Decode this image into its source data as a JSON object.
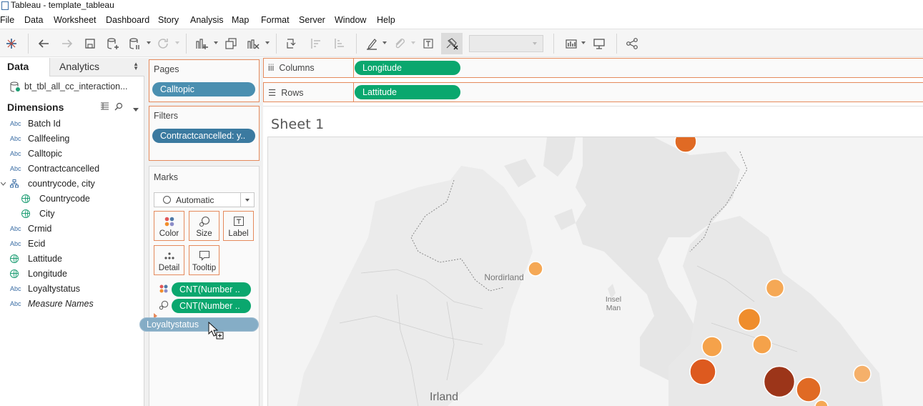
{
  "window": {
    "title": "Tableau - template_tableau"
  },
  "menu": [
    "File",
    "Data",
    "Worksheet",
    "Dashboard",
    "Story",
    "Analysis",
    "Map",
    "Format",
    "Server",
    "Window",
    "Help"
  ],
  "toolbar": {
    "icons": [
      "tableau-logo-icon",
      "undo-icon",
      "redo-icon",
      "save-icon",
      "new-data-source-icon",
      "pause-updates-icon",
      "refresh-icon",
      "new-worksheet-icon",
      "duplicate-sheet-icon",
      "clear-sheet-icon",
      "swap-icon",
      "sort-ascending-icon",
      "sort-descending-icon",
      "highlight-icon",
      "group-icon",
      "show-labels-icon",
      "fix-axes-icon",
      "fit-select",
      "show-me-icon",
      "presentation-icon",
      "share-icon"
    ],
    "fit_select_value": ""
  },
  "data_pane": {
    "tabs": {
      "data": "Data",
      "analytics": "Analytics"
    },
    "datasource": "bt_tbl_all_cc_interaction...",
    "dimensions_heading": "Dimensions",
    "fields": [
      {
        "type": "Abc",
        "name": "Batch Id"
      },
      {
        "type": "Abc",
        "name": "Callfeeling"
      },
      {
        "type": "Abc",
        "name": "Calltopic"
      },
      {
        "type": "Abc",
        "name": "Contractcancelled"
      },
      {
        "type": "hierarchy",
        "name": "countrycode, city"
      },
      {
        "type": "geo",
        "name": "Countrycode",
        "child": true
      },
      {
        "type": "geo",
        "name": "City",
        "child": true
      },
      {
        "type": "Abc",
        "name": "Crmid"
      },
      {
        "type": "Abc",
        "name": "Ecid"
      },
      {
        "type": "geo",
        "name": "Lattitude"
      },
      {
        "type": "geo",
        "name": "Longitude"
      },
      {
        "type": "Abc",
        "name": "Loyaltystatus"
      },
      {
        "type": "Abc",
        "name": "Measure Names",
        "italic": true
      }
    ]
  },
  "pages": {
    "heading": "Pages",
    "pill": "Calltopic"
  },
  "filters": {
    "heading": "Filters",
    "pill": "Contractcancelled: y.."
  },
  "marks": {
    "heading": "Marks",
    "mark_type": "Automatic",
    "buttons": [
      "Color",
      "Size",
      "Label",
      "Detail",
      "Tooltip"
    ],
    "pills": [
      {
        "encoding": "color",
        "label": "CNT(Number .."
      },
      {
        "encoding": "size",
        "label": "CNT(Number .."
      }
    ]
  },
  "dragging_pill": "Loyaltystatus",
  "shelves": {
    "columns": {
      "label": "Columns",
      "pill": "Longitude"
    },
    "rows": {
      "label": "Rows",
      "pill": "Lattitude"
    }
  },
  "sheet": {
    "title": "Sheet 1"
  },
  "map": {
    "labels": [
      "Nordirland",
      "Insel\nMan",
      "Irland"
    ],
    "colors": {
      "small": "#f5a855",
      "medium": "#ef8d2c",
      "large": "#dd5a1f",
      "largest": "#9c3519"
    }
  }
}
